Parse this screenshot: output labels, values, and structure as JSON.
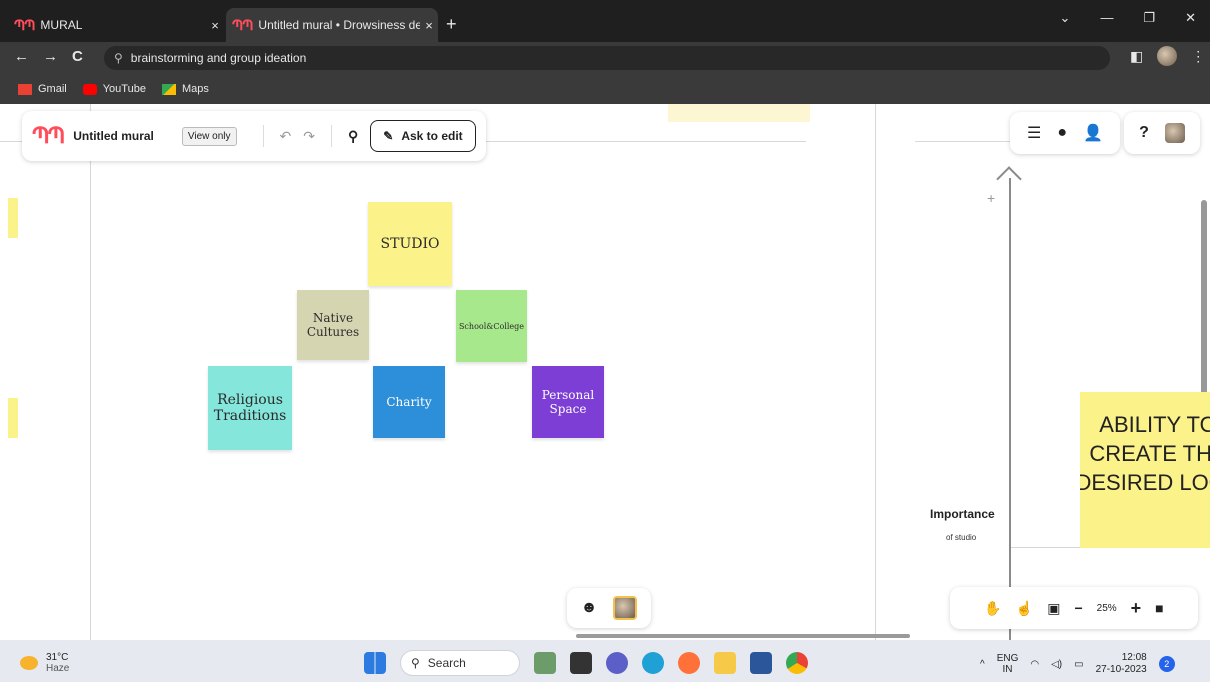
{
  "browser": {
    "tabs": [
      {
        "label": "MURAL",
        "close": "×"
      },
      {
        "label": "Untitled mural • Drowsiness dete",
        "close": "×"
      }
    ],
    "new_tab": "+",
    "nav": {
      "back": "←",
      "forward": "→",
      "reload": "C"
    },
    "address": "brainstorming and group ideation",
    "bookmarks": [
      "Gmail",
      "YouTube",
      "Maps"
    ]
  },
  "toolbar": {
    "title": "Untitled mural",
    "view_only": "View only",
    "ask_to_edit": "Ask to edit"
  },
  "stickies": {
    "studio": "STUDIO",
    "native": "Native Cultures",
    "school": "School&College",
    "religious": "Religious Traditions",
    "charity": "Charity",
    "personal": "Personal Space",
    "ability": "ABILITY TO CREATE THE DESIRED LOOK"
  },
  "axis": {
    "plus": "+",
    "label": "Importance",
    "sublabel": "of studio"
  },
  "zoom": {
    "level": "25%",
    "minus": "−",
    "plus": "+"
  },
  "taskbar": {
    "temperature": "31°C",
    "condition": "Haze",
    "search_placeholder": "Search",
    "language_1": "ENG",
    "language_2": "IN",
    "time": "12:08",
    "date": "27-10-2023",
    "notifications": "2"
  },
  "colors": {
    "studio": "#fbf28a",
    "native": "#d6d5b2",
    "school": "#a8e88c",
    "religious": "#85e6db",
    "charity": "#2d8fd9",
    "personal": "#7c3ed4",
    "ability": "#fbf28a"
  }
}
